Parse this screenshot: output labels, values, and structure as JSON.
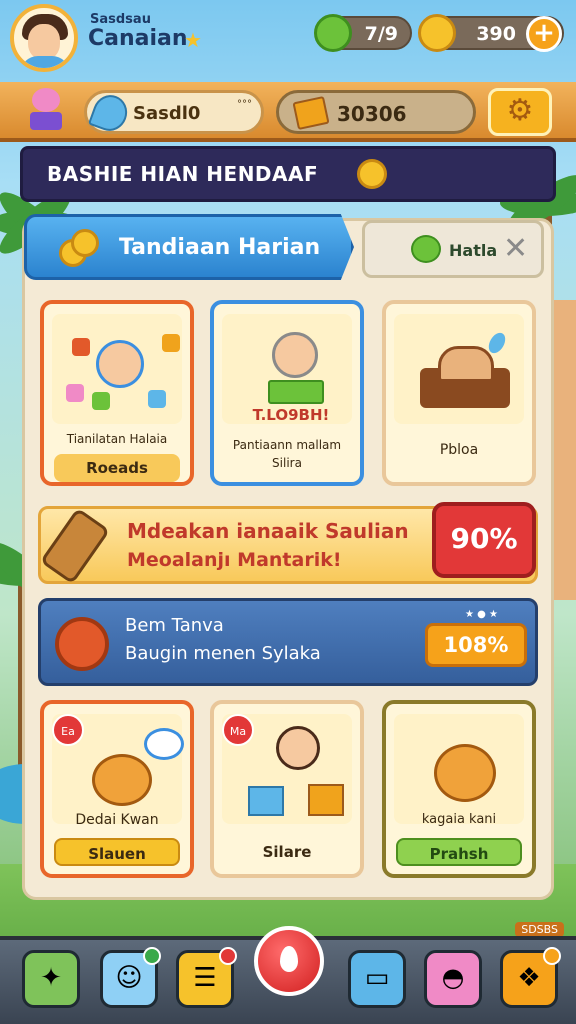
{
  "player": {
    "sub_label": "Sasdsau",
    "name": "Canaian"
  },
  "resources": {
    "green_value": "7/9",
    "gold_value": "390",
    "plus_label": "+"
  },
  "toolbar": {
    "search_value": "Sasdl0",
    "search_sup": "°°°",
    "score_value": "30306",
    "gear_icon": "gear-icon"
  },
  "banner": {
    "title": "BASHIE HIAN HENDAAF"
  },
  "tabs": [
    {
      "label": "Tandiaan Harian",
      "active": true
    },
    {
      "label": "Hatla",
      "active": false
    }
  ],
  "cards_top": [
    {
      "label": "Tianilatan Halaia",
      "pill": "Roeads"
    },
    {
      "label": "Pantiaann mallam",
      "pill": "Silira",
      "sign": "T.LO9BH!"
    },
    {
      "label": "Pbloa",
      "pill": ""
    }
  ],
  "promo": {
    "line1": "Mdeakan ianaaik Saulian",
    "line2": "Meoalanjı Mantarik!",
    "badge": "90%"
  },
  "quest": {
    "line1": "Bem Tanva",
    "line2": "Baugin menen Sylaka",
    "button": "108%"
  },
  "cards_bottom": [
    {
      "label": "Dedai Kwan",
      "pill": "Slauen",
      "tag": "Ea"
    },
    {
      "label": "",
      "pill": "Silare",
      "tag": "Ma"
    },
    {
      "label": "kagaia kani",
      "pill": "Prahsh"
    }
  ],
  "version": "SDSBS",
  "colors": {
    "accent_blue": "#2b83cf",
    "accent_orange": "#f6a21a",
    "promo_red": "#c0392b",
    "banner_navy": "#2e2a5a"
  }
}
